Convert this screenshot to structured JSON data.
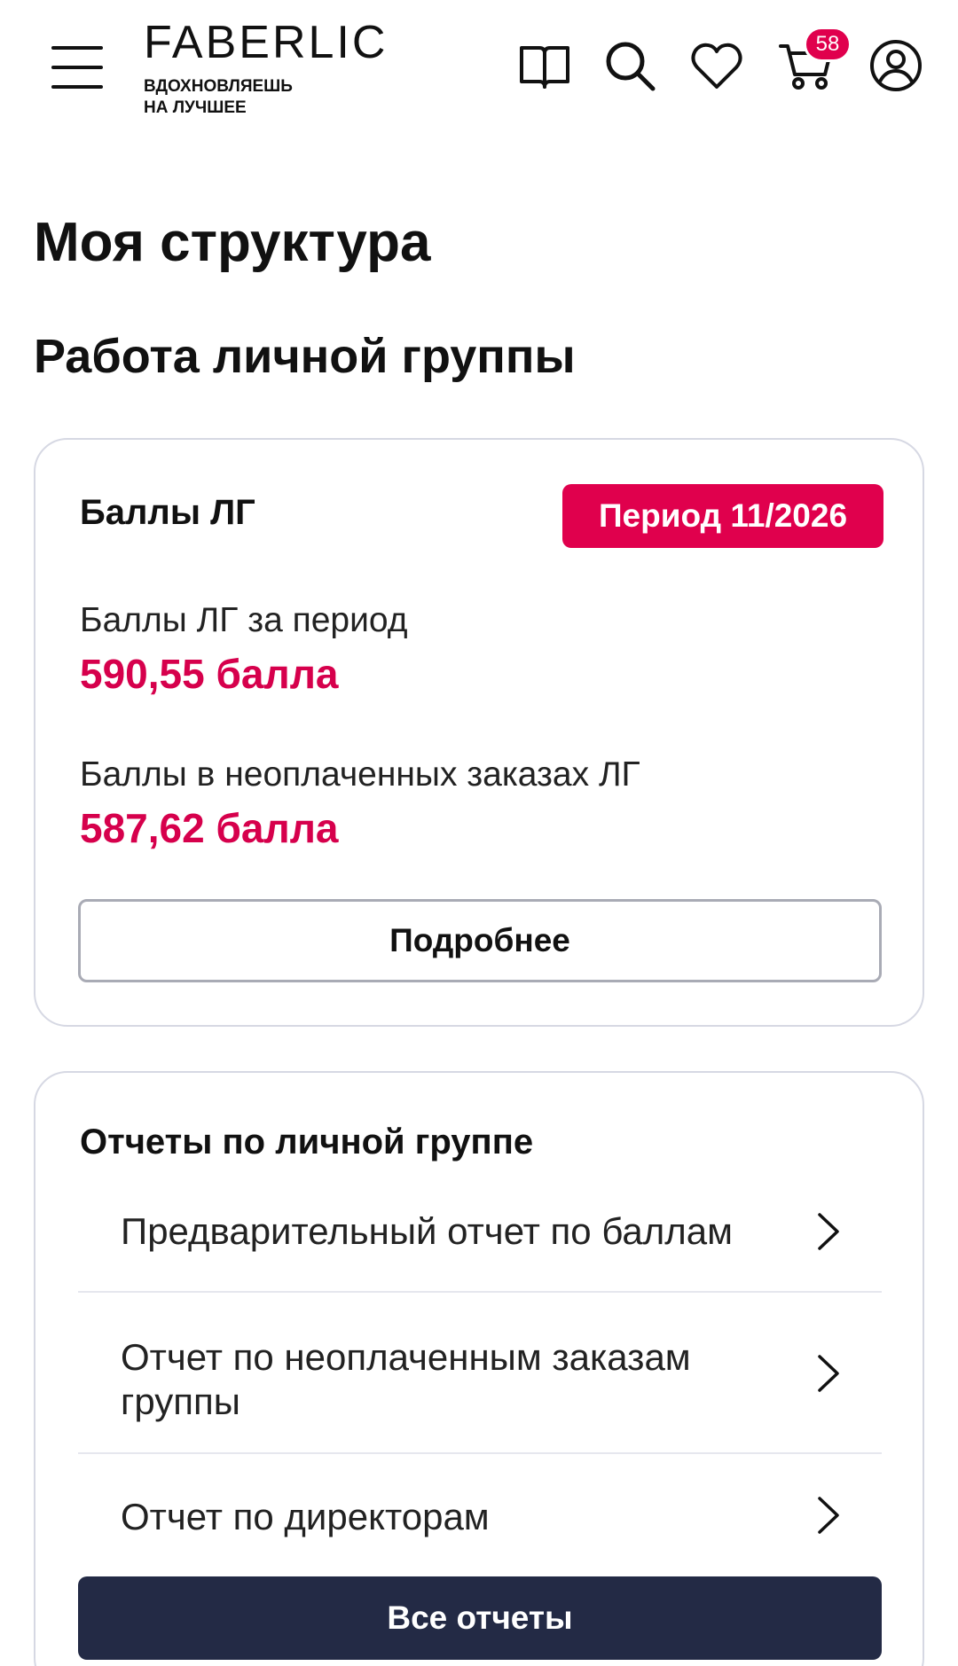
{
  "header": {
    "logo_name": "FABERLIC",
    "logo_tagline_1": "ВДОХНОВЛЯЕШЬ",
    "logo_tagline_2": "НА ЛУЧШЕЕ",
    "cart_count": "58",
    "icons": [
      "menu-icon",
      "catalog-book-icon",
      "search-icon",
      "heart-icon",
      "cart-icon",
      "profile-icon"
    ]
  },
  "page": {
    "title": "Моя структура",
    "section_title": "Работа личной группы"
  },
  "points_card": {
    "title": "Баллы ЛГ",
    "period_badge": "Период 11/2026",
    "period_points_label": "Баллы ЛГ за период",
    "period_points_value": "590,55 балла",
    "unpaid_points_label": "Баллы в неоплаченных заказах ЛГ",
    "unpaid_points_value": "587,62 балла",
    "details_button": "Подробнее"
  },
  "reports_card": {
    "title": "Отчеты по личной группе",
    "items": [
      {
        "label": "Предварительный отчет по баллам"
      },
      {
        "label": "Отчет по неоплаченным заказам группы"
      },
      {
        "label": "Отчет по директорам"
      }
    ],
    "all_reports_button": "Все отчеты"
  },
  "colors": {
    "accent": "#e0004d",
    "value_text": "#d6004c",
    "dark_button": "#232a45",
    "card_border": "#d6d8e3"
  }
}
